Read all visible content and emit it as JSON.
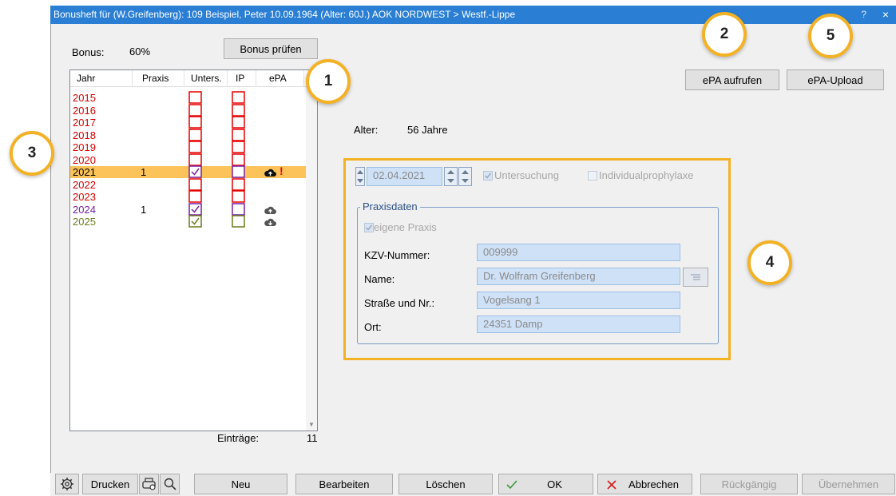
{
  "window": {
    "title": "Bonusheft für (W.Greifenberg): 109  Beispiel, Peter 10.09.1964  (Alter: 60J.)  AOK NORDWEST > Westf.-Lippe",
    "help": "?",
    "close": "×"
  },
  "bonus": {
    "label": "Bonus:",
    "value": "60%",
    "check_button": "Bonus prüfen"
  },
  "list": {
    "columns": [
      "Jahr",
      "Praxis",
      "Unters.",
      "IP",
      "ePA"
    ],
    "rows": [
      {
        "year": "2015",
        "praxis": "",
        "color": "#d40000"
      },
      {
        "year": "2016",
        "praxis": "",
        "color": "#d40000"
      },
      {
        "year": "2017",
        "praxis": "",
        "color": "#d40000"
      },
      {
        "year": "2018",
        "praxis": "",
        "color": "#d40000"
      },
      {
        "year": "2019",
        "praxis": "",
        "color": "#d40000"
      },
      {
        "year": "2020",
        "praxis": "",
        "color": "#d40000"
      },
      {
        "year": "2021",
        "praxis": "1",
        "color": "#000000"
      },
      {
        "year": "2022",
        "praxis": "",
        "color": "#d40000"
      },
      {
        "year": "2023",
        "praxis": "",
        "color": "#d40000"
      },
      {
        "year": "2024",
        "praxis": "1",
        "color": "#7a1fa2"
      },
      {
        "year": "2025",
        "praxis": "",
        "color": "#6b7a1a"
      }
    ],
    "entries_label": "Einträge:",
    "entries_count": "11",
    "warning_mark": "!"
  },
  "actions": {
    "epa_open": "ePA aufrufen",
    "epa_upload": "ePA-Upload"
  },
  "age": {
    "label": "Alter:",
    "value": "56 Jahre"
  },
  "form": {
    "date": "02.04.2021",
    "check_exam": "Untersuchung",
    "check_ip": "Individualprophylaxe",
    "group_title": "Praxisdaten",
    "own_practice": "eigene Praxis",
    "kzv_label": "KZV-Nummer:",
    "kzv_value": "009999",
    "name_label": "Name:",
    "name_value": "Dr. Wolfram Greifenberg",
    "street_label": "Straße und Nr.:",
    "street_value": "Vogelsang 1",
    "city_label": "Ort:",
    "city_value": "24351 Damp"
  },
  "badges": {
    "b1": "1",
    "b2": "2",
    "b3": "3",
    "b4": "4",
    "b5": "5"
  },
  "toolbar": {
    "print": "Drucken",
    "new": "Neu",
    "edit": "Bearbeiten",
    "delete": "Löschen",
    "ok": "OK",
    "cancel": "Abbrechen",
    "undo": "Rückgängig",
    "apply": "Übernehmen"
  },
  "colors": {
    "accent": "#f3b225",
    "title_bar": "#2a7fd4",
    "selected_row": "#fbc35a",
    "field_bg": "#cfe1f7"
  }
}
